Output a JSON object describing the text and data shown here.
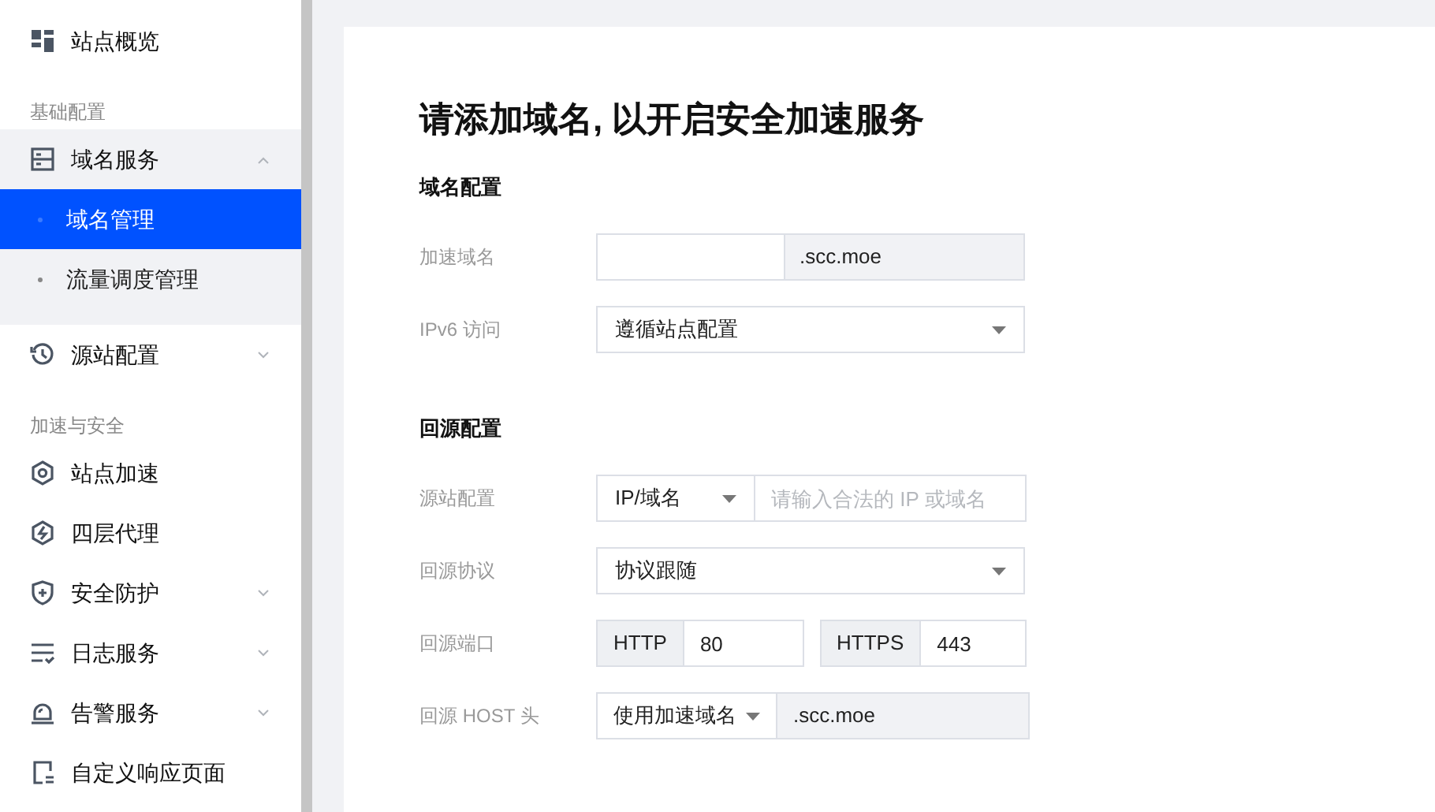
{
  "sidebar": [
    {
      "kind": "item",
      "label": "站点概览"
    },
    {
      "kind": "heading",
      "label": "基础配置"
    },
    {
      "kind": "item",
      "label": "域名服务",
      "expanded": true,
      "children": [
        {
          "label": "域名管理",
          "selected": true
        },
        {
          "label": "流量调度管理",
          "selected": false
        }
      ]
    },
    {
      "kind": "item",
      "label": "源站配置",
      "expanded": false
    },
    {
      "kind": "heading",
      "label": "加速与安全"
    },
    {
      "kind": "item",
      "label": "站点加速"
    },
    {
      "kind": "item",
      "label": "四层代理"
    },
    {
      "kind": "item",
      "label": "安全防护",
      "expanded": false
    },
    {
      "kind": "item",
      "label": "日志服务",
      "expanded": false
    },
    {
      "kind": "item",
      "label": "告警服务",
      "expanded": false
    },
    {
      "kind": "item",
      "label": "自定义响应页面"
    }
  ],
  "form": {
    "title": "请添加域名, 以开启安全加速服务",
    "sections": [
      {
        "heading": "域名配置",
        "fields": [
          {
            "kind": "suffix_input",
            "label": "加速域名",
            "suffix": ".scc.moe"
          },
          {
            "kind": "select",
            "label": "IPv6 访问",
            "value": "遵循站点配置"
          }
        ]
      },
      {
        "heading": "回源配置",
        "fields": [
          {
            "kind": "select_input",
            "label": "源站配置",
            "select": "IP/域名",
            "placeholder": "请输入合法的 IP 或域名"
          },
          {
            "kind": "select",
            "label": "回源协议",
            "value": "协议跟随"
          },
          {
            "kind": "ports",
            "label": "回源端口",
            "ports": [
              {
                "prefix": "HTTP",
                "value": "80"
              },
              {
                "prefix": "HTTPS",
                "value": "443"
              }
            ]
          },
          {
            "kind": "select_suffix",
            "label": "回源 HOST 头",
            "select": "使用加速域名",
            "suffix": ".scc.moe"
          }
        ]
      }
    ]
  }
}
